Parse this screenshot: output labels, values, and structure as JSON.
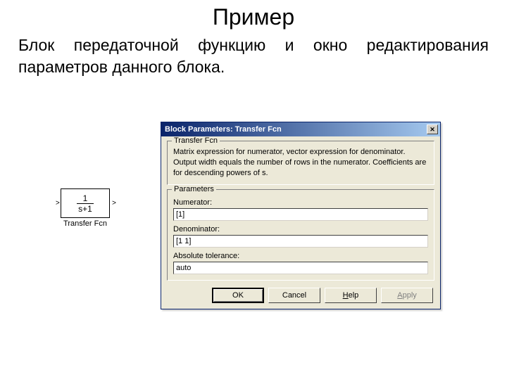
{
  "slide": {
    "title": "Пример",
    "text": "Блок передаточной функцию и окно редактирования параметров данного блока."
  },
  "block": {
    "numer": "1",
    "denom": "s+1",
    "label": "Transfer Fcn"
  },
  "dialog": {
    "title": "Block Parameters: Transfer Fcn",
    "section_block": "Transfer Fcn",
    "description": "Matrix expression for numerator, vector expression for denominator. Output width equals the number of rows in the numerator. Coefficients are for descending powers of s.",
    "section_params": "Parameters",
    "labels": {
      "numerator": "Numerator:",
      "denominator": "Denominator:",
      "abstol": "Absolute tolerance:"
    },
    "values": {
      "numerator": "[1]",
      "denominator": "[1 1]",
      "abstol": "auto"
    },
    "buttons": {
      "ok": "OK",
      "cancel": "Cancel",
      "help": "Help",
      "apply": "Apply"
    }
  }
}
